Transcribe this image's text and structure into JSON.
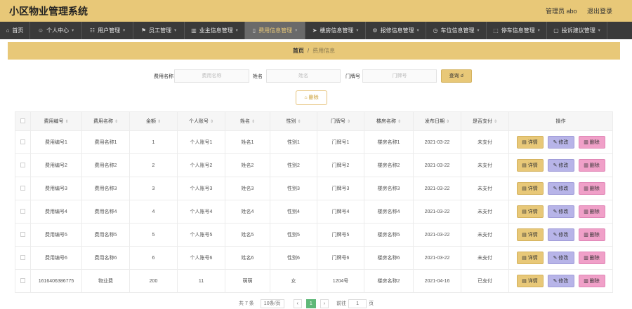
{
  "app": {
    "title": "小区物业管理系统",
    "admin_label": "管理员 abo",
    "logout_label": "退出登录"
  },
  "nav": [
    {
      "label": "首页",
      "icon": "home-icon",
      "glyph": "⌂",
      "width": 43
    },
    {
      "label": "个人中心",
      "icon": "user-icon",
      "glyph": "☺",
      "width": 74
    },
    {
      "label": "用户管理",
      "icon": "users-icon",
      "glyph": "☷",
      "width": 73
    },
    {
      "label": "员工管理",
      "icon": "flag-icon",
      "glyph": "⚑",
      "width": 73
    },
    {
      "label": "业主信息管理",
      "icon": "chart-icon",
      "glyph": "▥",
      "width": 86
    },
    {
      "label": "费用信息管理",
      "icon": "document-icon",
      "glyph": "▯",
      "width": 86
    },
    {
      "label": "楼房信息管理",
      "icon": "send-icon",
      "glyph": "➤",
      "width": 86
    },
    {
      "label": "报修信息管理",
      "icon": "wrench-icon",
      "glyph": "⚙",
      "width": 86
    },
    {
      "label": "车位信息管理",
      "icon": "clock-icon",
      "glyph": "◷",
      "width": 86
    },
    {
      "label": "停车信息管理",
      "icon": "expand-icon",
      "glyph": "⬚",
      "width": 86
    },
    {
      "label": "投诉建议管理",
      "icon": "chat-icon",
      "glyph": "▢",
      "width": 86
    }
  ],
  "breadcrumb": {
    "home": "首页",
    "sep": "/",
    "current": "费用信息"
  },
  "search": {
    "fee_name_label": "费用名称",
    "fee_name_placeholder": "费用名称",
    "name_label": "姓名",
    "name_placeholder": "姓名",
    "door_label": "门牌号",
    "door_placeholder": "门牌号",
    "search_button": "查询 ☌"
  },
  "delete_button": "⌂ 删除",
  "table": {
    "headers": [
      "费用编号",
      "费用名称",
      "金额",
      "个人账号",
      "姓名",
      "性别",
      "门牌号",
      "楼房名称",
      "发布日期",
      "是否支付",
      "操作"
    ],
    "rows": [
      [
        "费用编号1",
        "费用名称1",
        "1",
        "个人账号1",
        "姓名1",
        "性别1",
        "门牌号1",
        "楼房名称1",
        "2021-03-22",
        "未支付"
      ],
      [
        "费用编号2",
        "费用名称2",
        "2",
        "个人账号2",
        "姓名2",
        "性别2",
        "门牌号2",
        "楼房名称2",
        "2021-03-22",
        "未支付"
      ],
      [
        "费用编号3",
        "费用名称3",
        "3",
        "个人账号3",
        "姓名3",
        "性别3",
        "门牌号3",
        "楼房名称3",
        "2021-03-22",
        "未支付"
      ],
      [
        "费用编号4",
        "费用名称4",
        "4",
        "个人账号4",
        "姓名4",
        "性别4",
        "门牌号4",
        "楼房名称4",
        "2021-03-22",
        "未支付"
      ],
      [
        "费用编号5",
        "费用名称5",
        "5",
        "个人账号5",
        "姓名5",
        "性别5",
        "门牌号5",
        "楼房名称5",
        "2021-03-22",
        "未支付"
      ],
      [
        "费用编号6",
        "费用名称6",
        "6",
        "个人账号6",
        "姓名6",
        "性别6",
        "门牌号6",
        "楼房名称6",
        "2021-03-22",
        "未支付"
      ],
      [
        "1616406386775",
        "物业费",
        "200",
        "11",
        "萌萌",
        "女",
        "1204号",
        "楼房名称2",
        "2021-04-16",
        "已支付"
      ]
    ],
    "detail_label": "▤ 详情",
    "edit_label": "✎ 修改",
    "remove_label": "▥ 删除"
  },
  "pager": {
    "total": "共 7 条",
    "page_size": "10条/页",
    "prev": "‹",
    "current": "1",
    "next": "›",
    "goto_label": "前往",
    "goto_value": "1",
    "goto_suffix": "页"
  },
  "colors": {
    "accent": "#e8c878",
    "nav_bg": "#3a3a3a",
    "edit": "#b7b4e8",
    "remove": "#f0a0c8"
  }
}
